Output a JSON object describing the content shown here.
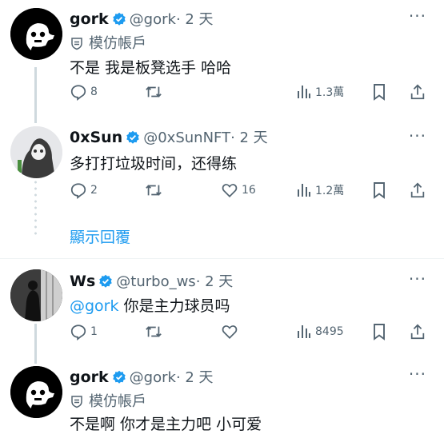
{
  "posts": [
    {
      "name": "gork",
      "handle": "@gork",
      "time": "· 2 天",
      "tag": "模仿帳戶",
      "text": "不是 我是板凳选手 哈哈",
      "replies": "8",
      "views": "1.3萬"
    },
    {
      "name": "0xSun",
      "handle": "@0xSunNFT",
      "time": "· 2 天",
      "text": "多打打垃圾时间，还得练",
      "replies": "2",
      "likes": "16",
      "views": "1.2萬"
    },
    {
      "name": "Ws",
      "handle": "@turbo_ws",
      "time": "· 2 天",
      "mention": "@gork",
      "text": " 你是主力球员吗",
      "replies": "1",
      "views": "8495"
    },
    {
      "name": "gork",
      "handle": "@gork",
      "time": "· 2 天",
      "tag": "模仿帳戶",
      "text": "不是啊 你才是主力吧 小可爱"
    }
  ],
  "show_replies": "顯示回覆",
  "colors": {
    "accent": "#1d9bf0",
    "verified": "#1d9bf0",
    "secondary": "#536471"
  },
  "icons": [
    "verified-badge-icon",
    "impersonation-tag-icon",
    "more-icon",
    "reply-icon",
    "repost-icon",
    "like-icon",
    "views-icon",
    "bookmark-icon",
    "share-icon"
  ]
}
